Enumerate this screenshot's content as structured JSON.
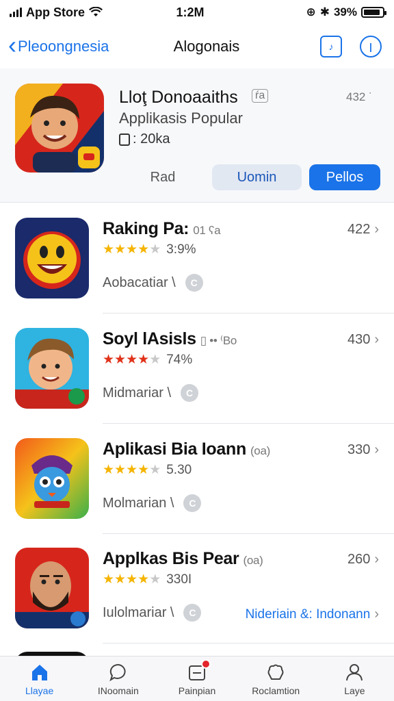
{
  "status": {
    "carrier": "App Store",
    "time": "1:2M",
    "battery": "39%",
    "battery_level": 0.9
  },
  "nav": {
    "back_label": "Pleoongnesia",
    "title": "Alogonais",
    "icons": [
      "music-note-icon",
      "info-icon"
    ]
  },
  "featured": {
    "name": "Lloţ Donoaaiths",
    "badge": "ŕa",
    "count": "432 ˙",
    "subtitle": "Applikasis Popular",
    "meta": ": 20ka",
    "segments": [
      "Rad",
      "Uomin",
      "Pellos"
    ]
  },
  "apps": [
    {
      "name": "Raking Pa:",
      "tag": "01 ʕa",
      "count": "422",
      "stars": 4,
      "star_color": "#f5b400",
      "rating": "3:9%",
      "category": "Aobacatiar \\",
      "link": ""
    },
    {
      "name": "Soyl lAsisls",
      "tag": "▯ •• ⁽Bo",
      "count": "430",
      "stars": 4,
      "star_color": "#e0321a",
      "rating": "74%",
      "category": "Midmariar \\",
      "link": ""
    },
    {
      "name": "Aplikasi Bia Ioann",
      "tag": "(oa)",
      "count": "330",
      "stars": 4,
      "star_color": "#f5b400",
      "rating": "5.30",
      "category": "Molmarian \\",
      "link": ""
    },
    {
      "name": "Applkas Bis Pear",
      "tag": "(oa)",
      "count": "260",
      "stars": 4,
      "star_color": "#f5b400",
      "rating": "330I",
      "category": "Iulolmariar \\",
      "link": "Nideriain &: Indonann"
    }
  ],
  "tabs": [
    {
      "label": "Llayae",
      "icon": "home-icon",
      "active": true
    },
    {
      "label": "INoomain",
      "icon": "chat-icon",
      "active": false
    },
    {
      "label": "Painpian",
      "icon": "inbox-icon",
      "active": false
    },
    {
      "label": "Roclamtion",
      "icon": "puzzle-icon",
      "active": false
    },
    {
      "label": "Laye",
      "icon": "person-icon",
      "active": false
    }
  ]
}
